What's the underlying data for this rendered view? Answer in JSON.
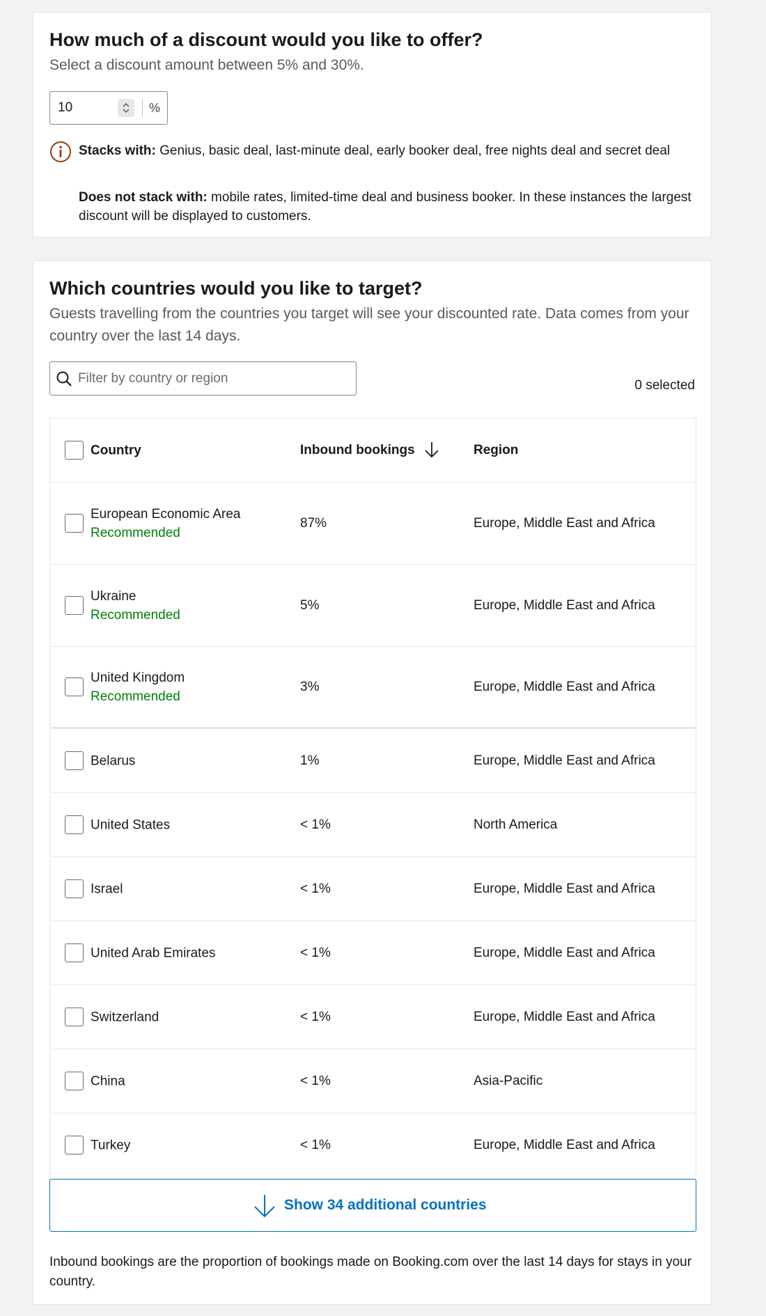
{
  "discount": {
    "heading": "How much of a discount would you like to offer?",
    "subtext": "Select a discount amount between 5% and 30%.",
    "value": "10",
    "unit": "%",
    "stacks_label": "Stacks with:",
    "stacks_text": "Genius, basic deal, last-minute deal, early booker deal, free nights deal and secret deal",
    "not_stacks_label": "Does not stack with:",
    "not_stacks_text": "mobile rates, limited-time deal and business booker. In these instances the largest discount will be displayed to customers."
  },
  "targeting": {
    "heading": "Which countries would you like to target?",
    "subtext": "Guests travelling from the countries you target will see your discounted rate. Data comes from your country over the last 14 days.",
    "search_placeholder": "Filter by country or region",
    "selected_count": "0 selected",
    "columns": {
      "country": "Country",
      "inbound": "Inbound bookings",
      "region": "Region"
    },
    "recommended_label": "Recommended",
    "rows": [
      {
        "country": "European Economic Area",
        "recommended": true,
        "inbound": "87%",
        "region": "Europe, Middle East and Africa"
      },
      {
        "country": "Ukraine",
        "recommended": true,
        "inbound": "5%",
        "region": "Europe, Middle East and Africa"
      },
      {
        "country": "United Kingdom",
        "recommended": true,
        "inbound": "3%",
        "region": "Europe, Middle East and Africa"
      },
      {
        "country": "Belarus",
        "recommended": false,
        "inbound": "1%",
        "region": "Europe, Middle East and Africa"
      },
      {
        "country": "United States",
        "recommended": false,
        "inbound": "< 1%",
        "region": "North America"
      },
      {
        "country": "Israel",
        "recommended": false,
        "inbound": "< 1%",
        "region": "Europe, Middle East and Africa"
      },
      {
        "country": "United Arab Emirates",
        "recommended": false,
        "inbound": "< 1%",
        "region": "Europe, Middle East and Africa"
      },
      {
        "country": "Switzerland",
        "recommended": false,
        "inbound": "< 1%",
        "region": "Europe, Middle East and Africa"
      },
      {
        "country": "China",
        "recommended": false,
        "inbound": "< 1%",
        "region": "Asia-Pacific"
      },
      {
        "country": "Turkey",
        "recommended": false,
        "inbound": "< 1%",
        "region": "Europe, Middle East and Africa"
      }
    ],
    "show_more_label": "Show 34 additional countries",
    "footnote": "Inbound bookings are the proportion of bookings made on Booking.com over the last 14 days for stays in your country."
  },
  "icons": {
    "info": "info-icon",
    "search": "search-icon",
    "sort": "arrow-down-icon",
    "stepper": "stepper-icon",
    "expand": "arrow-down-icon"
  },
  "colors": {
    "primary_blue": "#0071c2",
    "recommended_green": "#008009",
    "info_brown": "#923e01"
  }
}
